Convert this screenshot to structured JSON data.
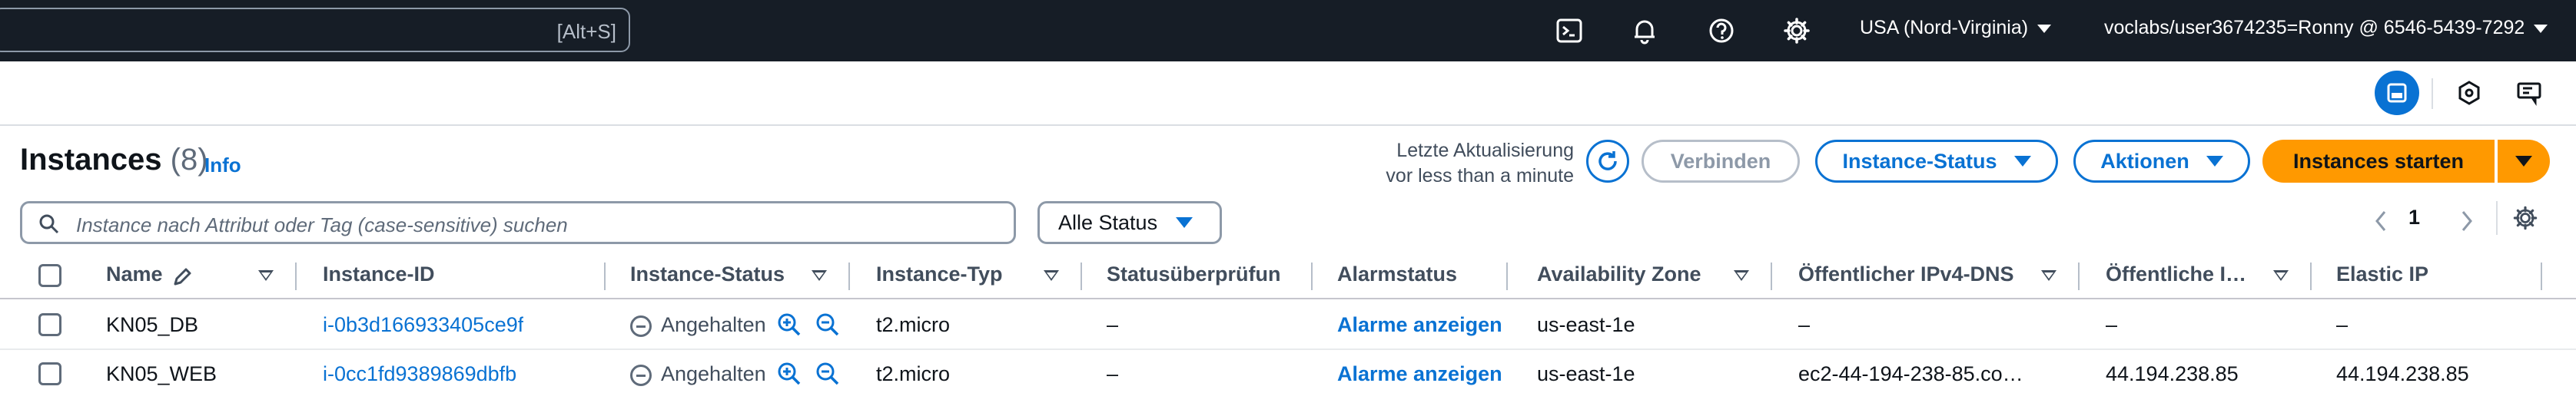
{
  "topnav": {
    "search_shortcut": "[Alt+S]",
    "region": "USA (Nord-Virginia)",
    "account": "voclabs/user3674235=Ronny @ 6546-5439-7292",
    "icons": [
      "cloudshell-icon",
      "bell-icon",
      "help-icon",
      "gear-icon"
    ]
  },
  "header": {
    "title": "Instances",
    "count": "(8)",
    "info": "Info",
    "last_update_label": "Letzte Aktualisierung",
    "last_update_value": "vor less than a minute",
    "connect": "Verbinden",
    "instance_status": "Instance-Status",
    "actions": "Aktionen",
    "launch": "Instances starten"
  },
  "filter": {
    "placeholder": "Instance nach Attribut oder Tag (case-sensitive) suchen",
    "status_select": "Alle Status"
  },
  "pagination": {
    "current_page": "1"
  },
  "table": {
    "columns": [
      "Name",
      "Instance-ID",
      "Instance-Status",
      "Instance-Typ",
      "Statusüberprüfun",
      "Alarmstatus",
      "Availability Zone",
      "Öffentlicher IPv4-DNS",
      "Öffentliche I…",
      "Elastic IP"
    ],
    "rows": [
      {
        "name": "KN05_DB",
        "instance_id": "i-0b3d166933405ce9f",
        "state": "Angehalten",
        "type": "t2.micro",
        "status_check": "–",
        "alarm": "Alarme anzeigen",
        "az": "us-east-1e",
        "public_dns": "–",
        "public_ip": "–",
        "elastic_ip": "–"
      },
      {
        "name": "KN05_WEB",
        "instance_id": "i-0cc1fd9389869dbfb",
        "state": "Angehalten",
        "type": "t2.micro",
        "status_check": "–",
        "alarm": "Alarme anzeigen",
        "az": "us-east-1e",
        "public_dns": "ec2-44-194-238-85.co…",
        "public_ip": "44.194.238.85",
        "elastic_ip": "44.194.238.85"
      }
    ]
  },
  "colors": {
    "nav_bg": "#161d26",
    "link_blue": "#0972d3",
    "primary_orange": "#ff9900"
  }
}
